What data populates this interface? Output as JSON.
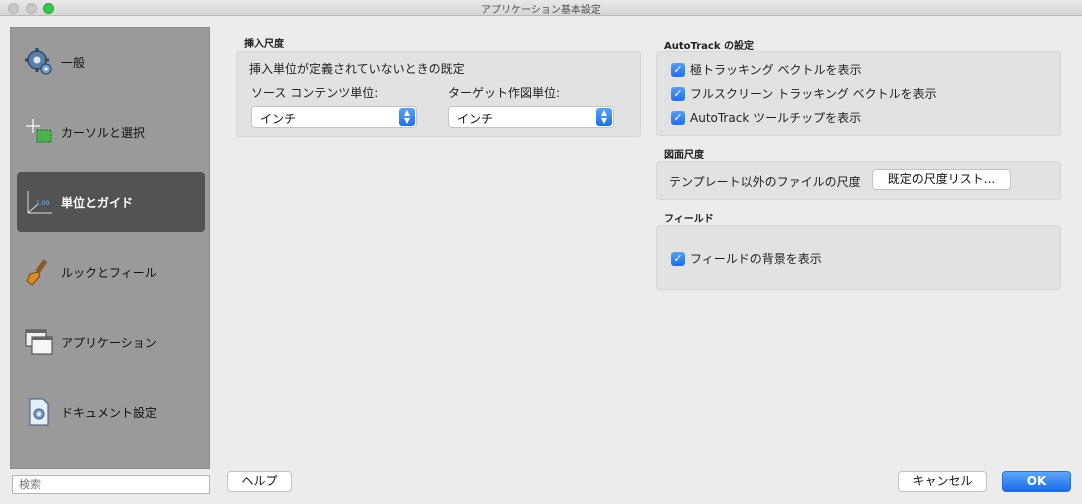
{
  "window": {
    "title": "アプリケーション基本設定"
  },
  "sidebar": {
    "items": [
      {
        "label": "一般",
        "icon": "gear-icon"
      },
      {
        "label": "カーソルと選択",
        "icon": "cursor-selection-icon"
      },
      {
        "label": "単位とガイド",
        "icon": "units-guide-icon",
        "selected": true
      },
      {
        "label": "ルックとフィール",
        "icon": "brush-icon"
      },
      {
        "label": "アプリケーション",
        "icon": "application-windows-icon"
      },
      {
        "label": "ドキュメント設定",
        "icon": "document-settings-icon"
      }
    ],
    "search_placeholder": "検索"
  },
  "insert_scale": {
    "section_title": "挿入尺度",
    "description": "挿入単位が定義されていないときの既定",
    "source_label": "ソース コンテンツ単位:",
    "source_value": "インチ",
    "target_label": "ターゲット作図単位:",
    "target_value": "インチ"
  },
  "autotrack": {
    "section_title": "AutoTrack の設定",
    "options": [
      {
        "label": "極トラッキング ベクトルを表示",
        "checked": true
      },
      {
        "label": "フルスクリーン トラッキング ベクトルを表示",
        "checked": true
      },
      {
        "label": "AutoTrack ツールチップを表示",
        "checked": true
      }
    ]
  },
  "drawing_scale": {
    "section_title": "図面尺度",
    "description": "テンプレート以外のファイルの尺度",
    "button_label": "既定の尺度リスト..."
  },
  "fields": {
    "section_title": "フィールド",
    "option_label": "フィールドの背景を表示",
    "option_checked": true
  },
  "footer": {
    "help_label": "ヘルプ",
    "cancel_label": "キャンセル",
    "ok_label": "OK"
  },
  "colors": {
    "accent": "#1f6fe3",
    "sidebar_bg": "#9a9a9a",
    "selected_bg": "#535353"
  }
}
